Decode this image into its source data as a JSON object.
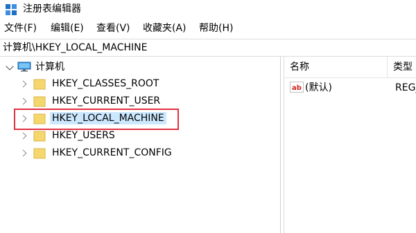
{
  "window": {
    "title": "注册表编辑器"
  },
  "menu": [
    "文件(F)",
    "编辑(E)",
    "查看(V)",
    "收藏夹(A)",
    "帮助(H)"
  ],
  "address": {
    "path": "计算机\\HKEY_LOCAL_MACHINE"
  },
  "tree": {
    "root": "计算机",
    "items": [
      {
        "label": "HKEY_CLASSES_ROOT"
      },
      {
        "label": "HKEY_CURRENT_USER"
      },
      {
        "label": "HKEY_LOCAL_MACHINE",
        "selected": true
      },
      {
        "label": "HKEY_USERS"
      },
      {
        "label": "HKEY_CURRENT_CONFIG"
      }
    ]
  },
  "list": {
    "columns": {
      "name": "名称",
      "type": "类型"
    },
    "rows": [
      {
        "name": "(默认)",
        "type": "REG_"
      }
    ]
  },
  "colors": {
    "selection": "#cce8ff",
    "highlight_border": "#e03040",
    "folder": "#f5d76e"
  },
  "icons": [
    "regedit-icon",
    "computer-icon",
    "folder-icon",
    "ab-string-icon"
  ]
}
